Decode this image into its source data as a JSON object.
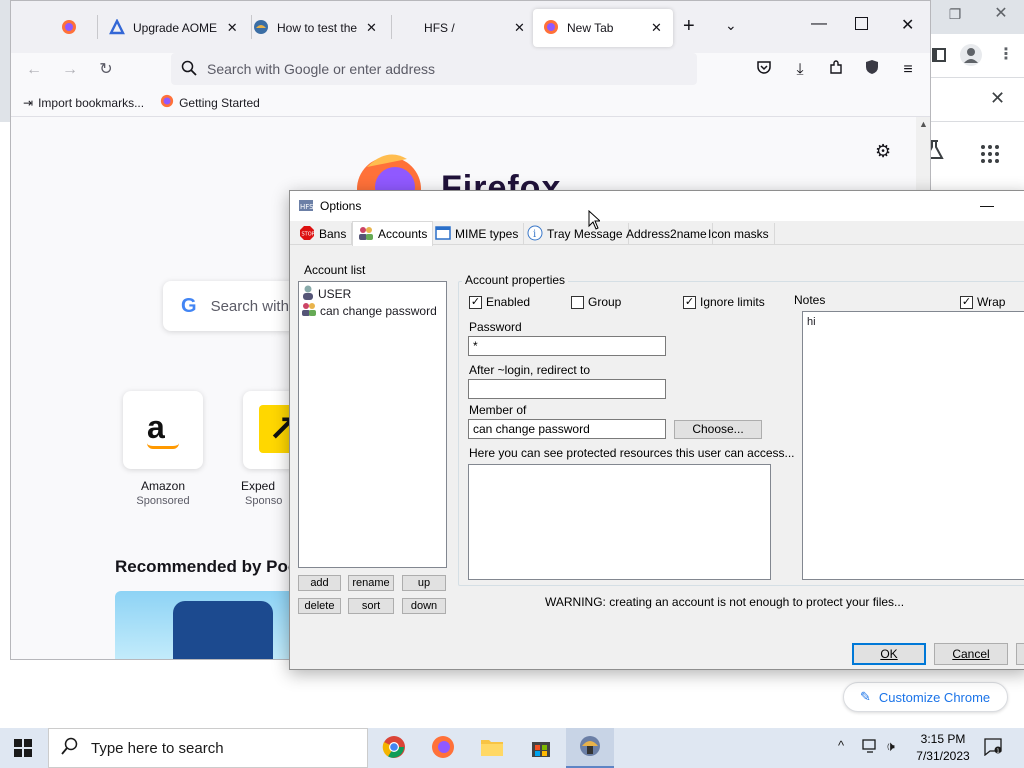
{
  "chrome": {
    "customize_label": "Customize Chrome"
  },
  "firefox": {
    "tabs": [
      {
        "label": ""
      },
      {
        "label": "Upgrade AOMEI"
      },
      {
        "label": "How to test the"
      },
      {
        "label": "HFS /"
      },
      {
        "label": "New Tab"
      }
    ],
    "url_placeholder": "Search with Google or enter address",
    "bookmarks": [
      {
        "label": "Import bookmarks..."
      },
      {
        "label": "Getting Started"
      }
    ],
    "logo_text": "Firefox",
    "search_placeholder": "Search with",
    "tiles": [
      {
        "label": "Amazon",
        "sub": "Sponsored"
      },
      {
        "label": "Exped",
        "sub": "Sponso"
      }
    ],
    "recommended_heading": "Recommended by Pock"
  },
  "dialog": {
    "title": "Options",
    "tabs": [
      {
        "label": "Bans"
      },
      {
        "label": "Accounts"
      },
      {
        "label": "MIME types"
      },
      {
        "label": "Tray Message"
      },
      {
        "label": "Address2name"
      },
      {
        "label": "Icon masks"
      }
    ],
    "account_list_label": "Account list",
    "accounts": [
      {
        "label": "USER"
      },
      {
        "label": "can change password"
      }
    ],
    "list_buttons": {
      "add": "add",
      "rename": "rename",
      "up": "up",
      "delete": "delete",
      "sort": "sort",
      "down": "down"
    },
    "properties_label": "Account properties",
    "enabled_label": "Enabled",
    "group_label": "Group",
    "ignore_limits_label": "Ignore limits",
    "enabled_checked": true,
    "group_checked": false,
    "ignore_limits_checked": true,
    "password_label": "Password",
    "password_value": "*",
    "redirect_label": "After ~login, redirect to",
    "redirect_value": "",
    "member_of_label": "Member of",
    "member_of_value": "can change password",
    "choose_label": "Choose...",
    "protected_label": "Here you can see protected resources this user can access...",
    "notes_label": "Notes",
    "wrap_label": "Wrap",
    "wrap_checked": true,
    "notes_value": "hi",
    "warning": "WARNING: creating an account is not enough to protect  your files...",
    "ok_label": "OK",
    "cancel_label": "Cancel"
  },
  "taskbar": {
    "search_placeholder": "Type here to search",
    "time": "3:15 PM",
    "date": "7/31/2023"
  }
}
